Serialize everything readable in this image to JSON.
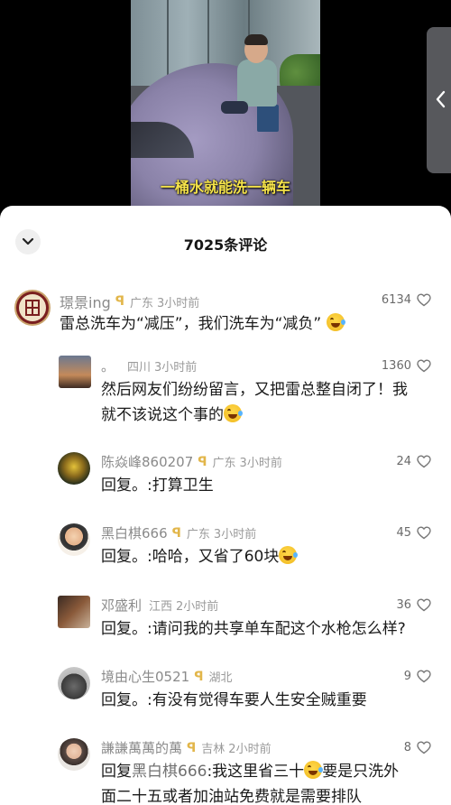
{
  "video": {
    "subtitle": "一桶水就能洗一辆车"
  },
  "sheet": {
    "comment_count": "7025条评论"
  },
  "comments": [
    {
      "name": "璟景ing",
      "location": "广东",
      "time": "3小时前",
      "likes": "6134",
      "text": "雷总洗车为“减压”，我们洗车为“减负”"
    },
    {
      "name": "。",
      "location": "四川",
      "time": "3小时前",
      "likes": "1360",
      "text_line1": "然后网友们纷纷留言，又把雷总整自闭了！我",
      "text_line2": "就不该说这个事的"
    },
    {
      "name": "陈焱峰860207",
      "location": "广东",
      "time": "3小时前",
      "likes": "24",
      "reply_prefix": "回复。",
      "text": ":打算卫生"
    },
    {
      "name": "黑白棋666",
      "location": "广东",
      "time": "3小时前",
      "likes": "45",
      "reply_prefix": "回复。",
      "text": ":哈哈，又省了60块"
    },
    {
      "name": "邓盛利",
      "location": "江西",
      "time": "2小时前",
      "likes": "36",
      "reply_prefix": "回复。",
      "text": ":请问我的共享单车配这个水枪怎么样?"
    },
    {
      "name": "境由心生0521",
      "location": "湖北",
      "time": "2小时前",
      "likes": "9",
      "reply_prefix": "回复。",
      "text": ":有没有觉得车要人生安全贼重要"
    },
    {
      "name": "謙謙萬萬的萬",
      "location": "吉林",
      "time": "2小时前",
      "likes": "8",
      "reply_prefix": "回复",
      "reply_target": "黑白棋666",
      "text_line1": ":我这里省三十",
      "text_line1b": "要是只洗外",
      "text_line2": "面二十五或者加油站免费就是需要排队"
    }
  ],
  "colors": {
    "badge": "#e2b64a",
    "subtitle": "#f5e34a",
    "meta": "#8a8a8a"
  },
  "icons": {
    "collapse": "chevron-down-icon",
    "like": "heart-outline-icon",
    "badge": "creator-badge-icon",
    "side": "chevron-left-icon"
  }
}
